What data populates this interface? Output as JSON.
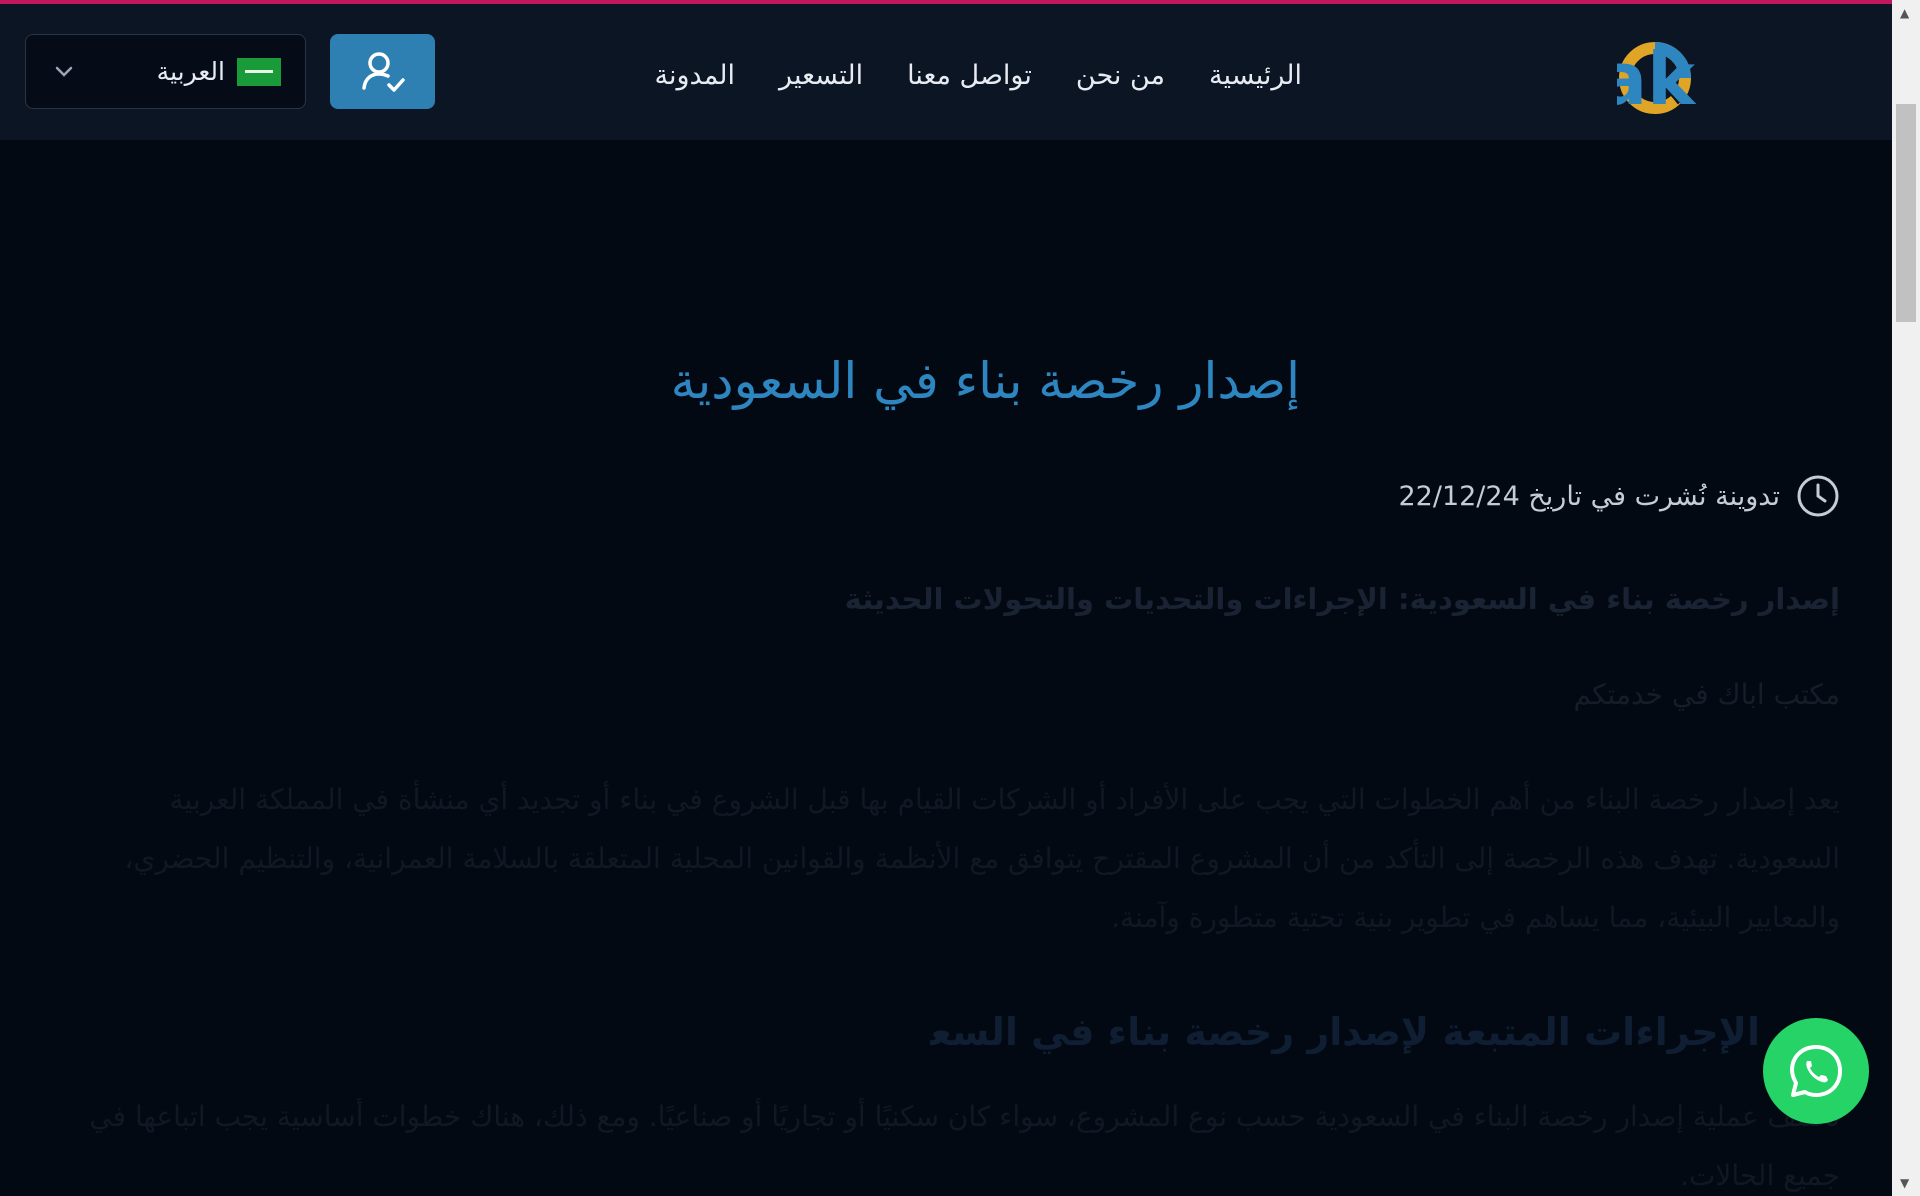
{
  "header": {
    "logo_text": "bak",
    "nav": [
      {
        "label": "الرئيسية"
      },
      {
        "label": "من نحن"
      },
      {
        "label": "تواصل معنا"
      },
      {
        "label": "التسعير"
      },
      {
        "label": "المدونة"
      }
    ],
    "language": {
      "selected": "العربية"
    }
  },
  "article": {
    "title": "إصدار رخصة بناء في السعودية",
    "published": "تدوينة نُشرت في تاريخ 22/12/24",
    "subtitle": "إصدار رخصة بناء في السعودية: الإجراءات والتحديات والتحولات الحديثة",
    "office_line": "مكتب اباك في خدمتكم",
    "paragraph_1": "يعد إصدار رخصة البناء من أهم الخطوات التي يجب على الأفراد أو الشركات القيام بها قبل الشروع في بناء أو تجديد أي منشأة في المملكة العربية السعودية. تهدف هذه الرخصة إلى التأكد من أن المشروع المقترح يتوافق مع الأنظمة والقوانين المحلية المتعلقة بالسلامة العمرانية، والتنظيم الحضري، والمعايير البيئية، مما يساهم في تطوير بنية تحتية متطورة وآمنة.",
    "section_heading": "الإجراءات المتبعة لإصدار رخصة بناء في السعودية",
    "paragraph_2": "تختلف عملية إصدار رخصة البناء في السعودية حسب نوع المشروع، سواء كان سكنيًا أو تجاريًا أو صناعيًا. ومع ذلك، هناك خطوات أساسية يجب اتباعها في جميع الحالات."
  },
  "colors": {
    "accent": "#2e7fb2",
    "title": "#2e86c1",
    "whatsapp": "#25d366",
    "background": "#030913",
    "header": "#0b1524"
  },
  "icons": {
    "user": "user-check-icon",
    "clock": "clock-icon",
    "whatsapp": "whatsapp-icon",
    "chevron": "chevron-down-icon"
  }
}
